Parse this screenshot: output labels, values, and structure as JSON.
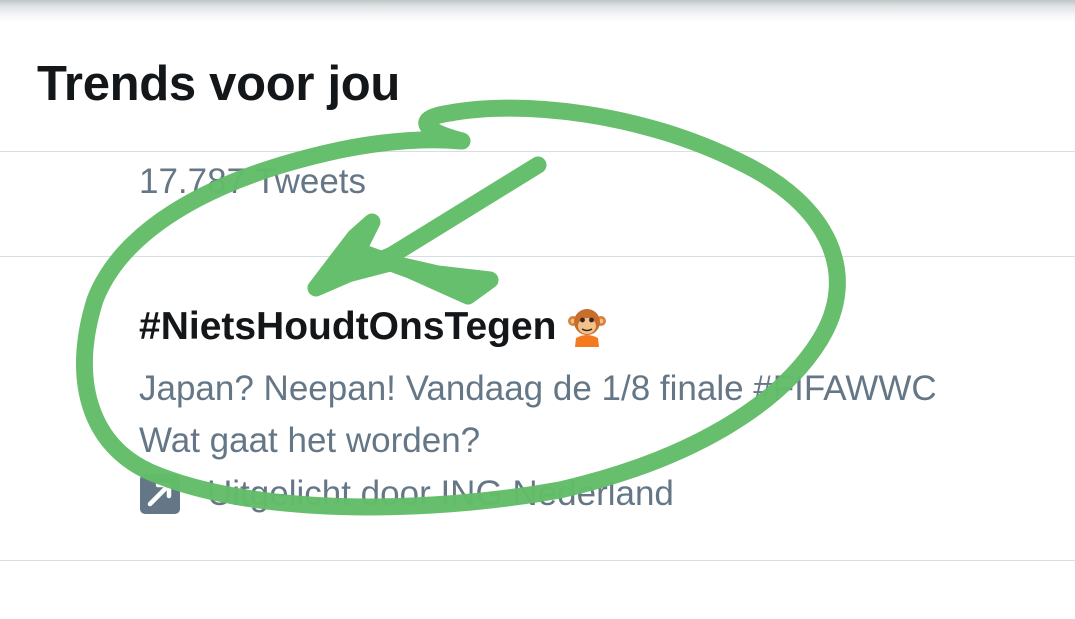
{
  "section": {
    "title": "Trends voor jou"
  },
  "trends": [
    {
      "tweet_count": "17.787 Tweets"
    },
    {
      "hashtag": "#NietsHoudtOnsTegen",
      "emoji_icon": "monkey-mascot-icon",
      "description_line1": "Japan? Neepan! Vandaag de 1/8 finale #FIFAWWC",
      "description_line2": "Wat gaat het worden?",
      "promoted_icon": "promoted-arrow-icon",
      "promoted_label": "Uitgelicht door ING Nederland"
    }
  ],
  "annotation": {
    "color": "#62bd68",
    "shapes": "circle-and-arrow"
  },
  "colors": {
    "primary_text": "#14171a",
    "secondary_text": "#657786",
    "divider": "#d7dde1"
  }
}
